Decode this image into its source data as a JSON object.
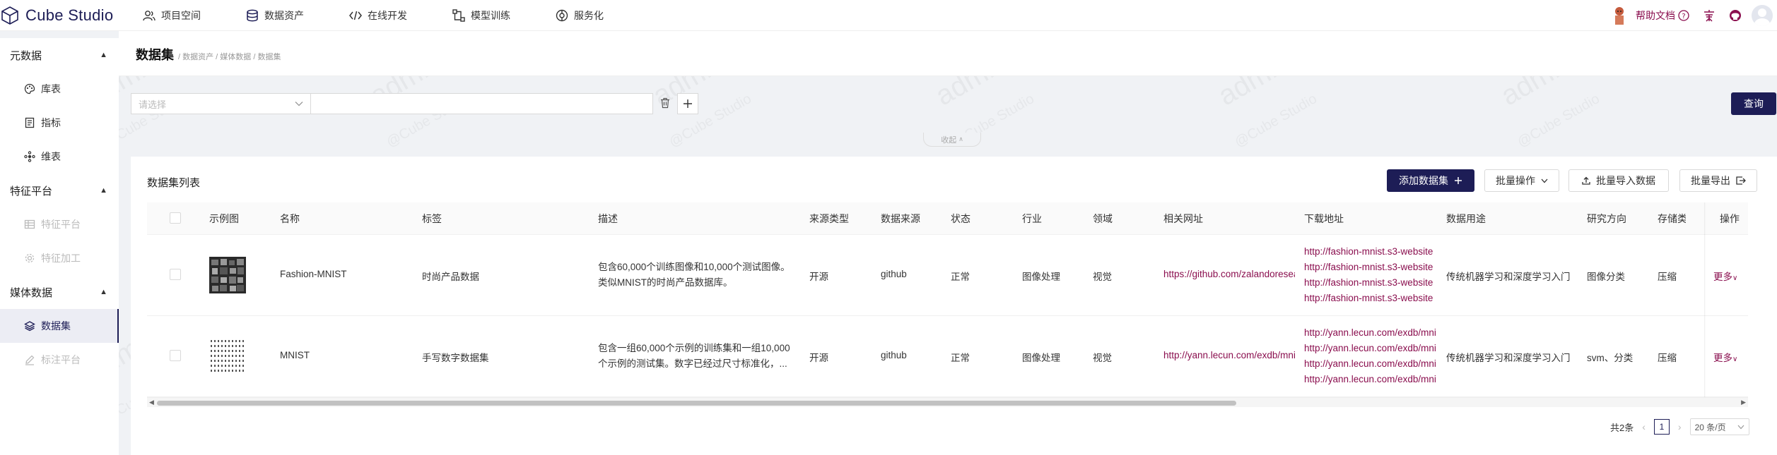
{
  "app": {
    "name": "Cube Studio"
  },
  "topnav": {
    "items": [
      {
        "label": "项目空间",
        "icon": "users-icon"
      },
      {
        "label": "数据资产",
        "icon": "database-icon"
      },
      {
        "label": "在线开发",
        "icon": "code-icon"
      },
      {
        "label": "模型训练",
        "icon": "pipeline-icon"
      },
      {
        "label": "服务化",
        "icon": "service-icon"
      }
    ],
    "help_label": "帮助文档"
  },
  "sidebar": {
    "groups": [
      {
        "label": "元数据",
        "items": [
          {
            "label": "库表",
            "disabled": false
          },
          {
            "label": "指标",
            "disabled": false
          },
          {
            "label": "维表",
            "disabled": false
          }
        ]
      },
      {
        "label": "特征平台",
        "items": [
          {
            "label": "特征平台",
            "disabled": true
          },
          {
            "label": "特征加工",
            "disabled": true
          }
        ]
      },
      {
        "label": "媒体数据",
        "items": [
          {
            "label": "数据集",
            "disabled": false,
            "active": true
          },
          {
            "label": "标注平台",
            "disabled": true
          }
        ]
      }
    ]
  },
  "page": {
    "title": "数据集",
    "breadcrumb": "/ 数据资产 / 媒体数据 / 数据集"
  },
  "filter": {
    "select_placeholder": "请选择",
    "query_label": "查询",
    "collapse_label": "收起"
  },
  "card": {
    "title": "数据集列表",
    "add_label": "添加数据集",
    "batch_label": "批量操作",
    "import_label": "批量导入数据",
    "export_label": "批量导出"
  },
  "table": {
    "columns": [
      "示例图",
      "名称",
      "标签",
      "描述",
      "来源类型",
      "数据来源",
      "状态",
      "行业",
      "领域",
      "相关网址",
      "下载地址",
      "数据用途",
      "研究方向",
      "存储类",
      "操作"
    ],
    "rows": [
      {
        "name": "Fashion-MNIST",
        "tag": "时尚产品数据",
        "desc_1": "包含60,000个训练图像和10,000个测试图像。",
        "desc_2": "类似MNIST的时尚产品数据库。",
        "source_type": "开源",
        "source": "github",
        "status": "正常",
        "industry": "图像处理",
        "field": "视觉",
        "url": "https://github.com/zalandoresearch/fashion-mnist",
        "downloads": [
          "http://fashion-mnist.s3-website",
          "http://fashion-mnist.s3-website",
          "http://fashion-mnist.s3-website",
          "http://fashion-mnist.s3-website"
        ],
        "usage": "传统机器学习和深度学习入门",
        "research": "图像分类",
        "storage": "压缩",
        "op": "更多"
      },
      {
        "name": "MNIST",
        "tag": "手写数字数据集",
        "desc_1": "包含一组60,000个示例的训练集和一组10,000",
        "desc_2": "个示例的测试集。数字已经过尺寸标准化，...",
        "source_type": "开源",
        "source": "github",
        "status": "正常",
        "industry": "图像处理",
        "field": "视觉",
        "url": "http://yann.lecun.com/exdb/mnist/",
        "downloads": [
          "http://yann.lecun.com/exdb/mnist/",
          "http://yann.lecun.com/exdb/mnist/",
          "http://yann.lecun.com/exdb/mnist/",
          "http://yann.lecun.com/exdb/mnist/"
        ],
        "usage": "传统机器学习和深度学习入门",
        "research": "svm、分类",
        "storage": "压缩",
        "op": "更多"
      }
    ]
  },
  "pagination": {
    "total": "共2条",
    "current": "1",
    "page_size": "20 条/页"
  },
  "watermark": {
    "big": "admin",
    "small": "@Cube Studio"
  },
  "colors": {
    "brand": "#1d1d56",
    "link": "#8a0e4e"
  }
}
